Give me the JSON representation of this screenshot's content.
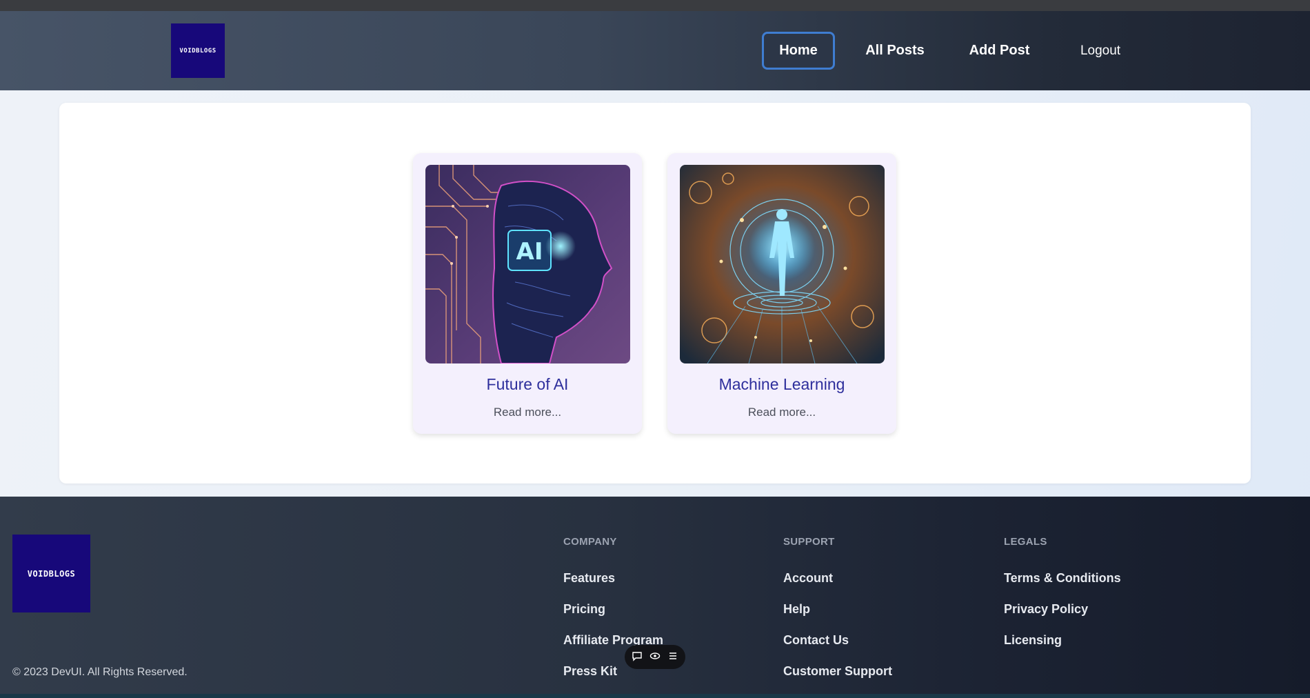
{
  "brand": {
    "logo_text": "VOIDBLOGS"
  },
  "nav": {
    "home": "Home",
    "all_posts": "All Posts",
    "add_post": "Add Post",
    "logout": "Logout"
  },
  "posts": [
    {
      "title": "Future of AI",
      "read_more": "Read more...",
      "image": "ai-head-circuit",
      "chip": "AI"
    },
    {
      "title": "Machine Learning",
      "read_more": "Read more...",
      "image": "ml-figure-cosmic"
    }
  ],
  "footer": {
    "company": {
      "heading": "COMPANY",
      "links": [
        "Features",
        "Pricing",
        "Affiliate Program",
        "Press Kit"
      ]
    },
    "support": {
      "heading": "SUPPORT",
      "links": [
        "Account",
        "Help",
        "Contact Us",
        "Customer Support"
      ]
    },
    "legals": {
      "heading": "LEGALS",
      "links": [
        "Terms & Conditions",
        "Privacy Policy",
        "Licensing"
      ]
    },
    "copyright": "© 2023 DevUI. All Rights Reserved."
  },
  "floating_toolbar": {
    "icons": [
      "chat-icon",
      "eye-icon",
      "menu-icon"
    ]
  },
  "colors": {
    "accent": "#3f7dd1",
    "logo_bg": "#17087a",
    "post_title": "#2e2f9c"
  }
}
